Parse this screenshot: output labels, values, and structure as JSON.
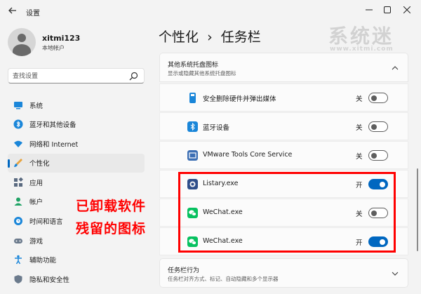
{
  "window": {
    "title": "设置",
    "controls": [
      "minimize",
      "maximize",
      "close"
    ]
  },
  "watermark": {
    "brand": "系统迷",
    "url": "www.xitmi.com"
  },
  "user": {
    "name": "xitmi123",
    "type": "本地帐户"
  },
  "search": {
    "placeholder": "查找设置"
  },
  "sidebar": {
    "items": [
      {
        "label": "系统",
        "icon": "system-icon"
      },
      {
        "label": "蓝牙和其他设备",
        "icon": "bluetooth-icon"
      },
      {
        "label": "网络和 Internet",
        "icon": "wifi-icon"
      },
      {
        "label": "个性化",
        "icon": "brush-icon",
        "active": true
      },
      {
        "label": "应用",
        "icon": "apps-icon"
      },
      {
        "label": "帐户",
        "icon": "account-icon"
      },
      {
        "label": "时间和语言",
        "icon": "globe-clock-icon"
      },
      {
        "label": "游戏",
        "icon": "gamepad-icon"
      },
      {
        "label": "辅助功能",
        "icon": "accessibility-icon"
      },
      {
        "label": "隐私和安全性",
        "icon": "shield-icon"
      }
    ]
  },
  "breadcrumb": {
    "parent": "个性化",
    "separator": "›",
    "current": "任务栏"
  },
  "tray_section": {
    "title": "其他系统托盘图标",
    "subtitle": "显示或隐藏其他系统托盘图标",
    "items": [
      {
        "label": "安全删除硬件并弹出媒体",
        "state": "关",
        "on": false,
        "icon": "usb-eject-icon"
      },
      {
        "label": "蓝牙设备",
        "state": "关",
        "on": false,
        "icon": "bluetooth-icon"
      },
      {
        "label": "VMware Tools Core Service",
        "state": "关",
        "on": false,
        "icon": "vmware-icon"
      },
      {
        "label": "Listary.exe",
        "state": "开",
        "on": true,
        "icon": "listary-icon"
      },
      {
        "label": "WeChat.exe",
        "state": "关",
        "on": false,
        "icon": "wechat-icon"
      },
      {
        "label": "WeChat.exe",
        "state": "开",
        "on": true,
        "icon": "wechat-icon"
      }
    ]
  },
  "behavior_section": {
    "title": "任务栏行为",
    "subtitle": "任务栏对齐方式、标记、自动隐藏和多个显示器"
  },
  "annotation": {
    "line1": "已卸载软件",
    "line2": "残留的图标",
    "color": "#ff0000"
  },
  "colors": {
    "accent": "#0067c0",
    "background": "#f3f3f3",
    "card": "#fbfbfb"
  }
}
